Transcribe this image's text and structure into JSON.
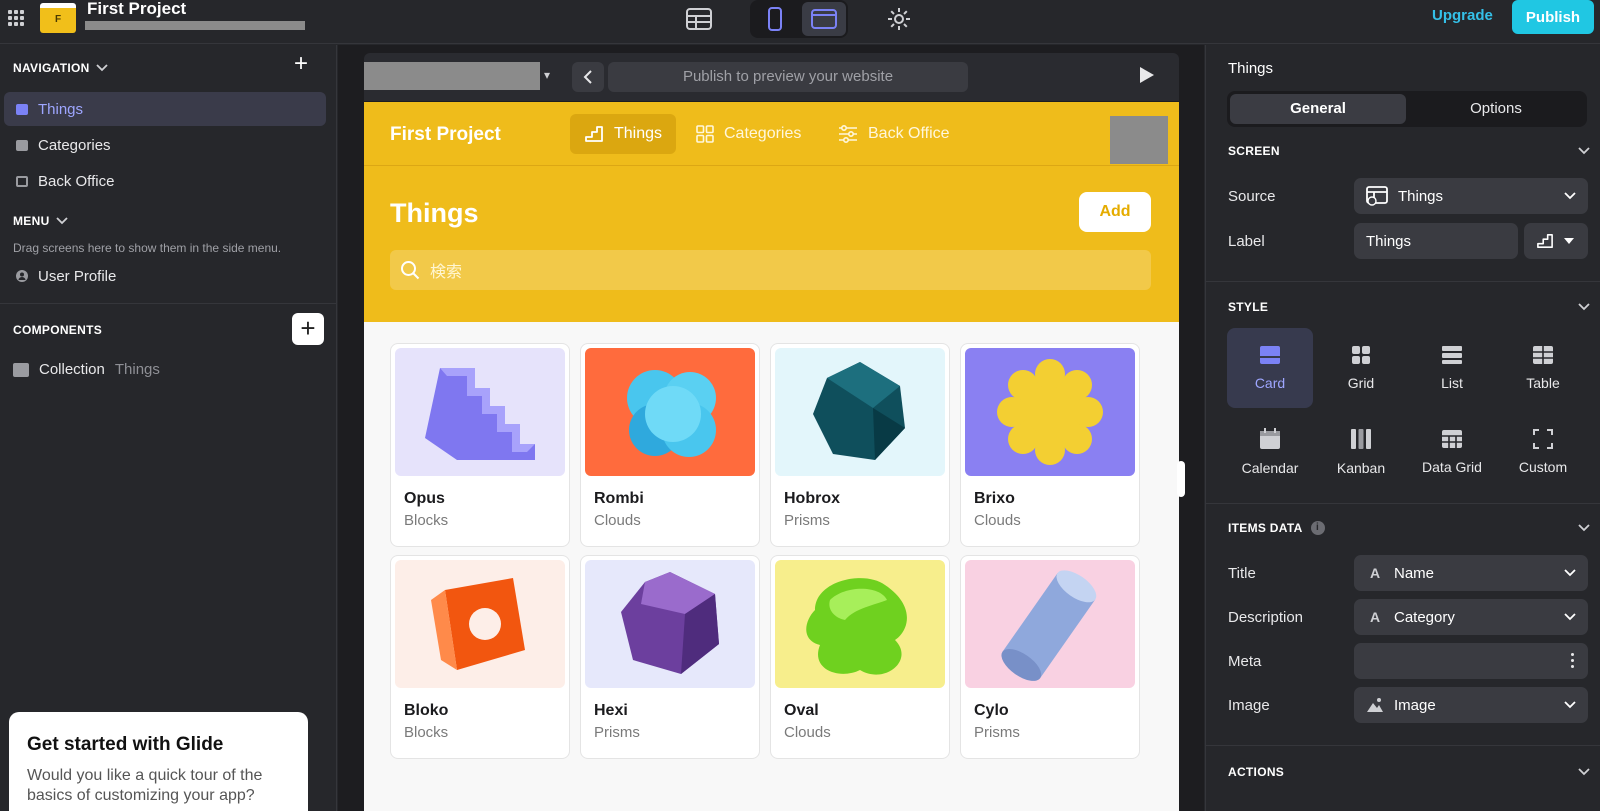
{
  "topbar": {
    "project_badge": "F",
    "project_title": "First Project",
    "upgrade_label": "Upgrade",
    "publish_label": "Publish"
  },
  "left": {
    "navigation_header": "NAVIGATION",
    "nav_items": [
      {
        "label": "Things",
        "icon": "card-icon",
        "active": true
      },
      {
        "label": "Categories",
        "icon": "card-icon"
      },
      {
        "label": "Back Office",
        "icon": "table-icon"
      }
    ],
    "menu_header": "MENU",
    "menu_hint": "Drag screens here to show them in the side menu.",
    "menu_items": [
      {
        "label": "User Profile",
        "icon": "user-icon"
      }
    ],
    "components_header": "COMPONENTS",
    "component": {
      "label": "Collection",
      "source": "Things"
    },
    "tour": {
      "title": "Get started with Glide",
      "text": "Would you like a quick tour of the basics of customizing your app?"
    }
  },
  "preview": {
    "url_placeholder": "Publish to preview your website",
    "app": {
      "brand": "First Project",
      "tabs": [
        {
          "label": "Things",
          "icon": "stairs-icon",
          "active": true
        },
        {
          "label": "Categories",
          "icon": "grid-icon"
        },
        {
          "label": "Back Office",
          "icon": "sliders-icon"
        }
      ],
      "screen_title": "Things",
      "add_label": "Add",
      "search_placeholder": "検索",
      "cards": [
        {
          "title": "Opus",
          "subtitle": "Blocks",
          "bg": "#e6e3fb",
          "shape": "stairs"
        },
        {
          "title": "Rombi",
          "subtitle": "Clouds",
          "bg": "#ff6b3d",
          "shape": "cloud"
        },
        {
          "title": "Hobrox",
          "subtitle": "Prisms",
          "bg": "#e3f6fb",
          "shape": "gem"
        },
        {
          "title": "Brixo",
          "subtitle": "Clouds",
          "bg": "#8a80f2",
          "shape": "star"
        },
        {
          "title": "Bloko",
          "subtitle": "Blocks",
          "bg": "#fdeee8",
          "shape": "cube"
        },
        {
          "title": "Hexi",
          "subtitle": "Prisms",
          "bg": "#e6e8fb",
          "shape": "hex"
        },
        {
          "title": "Oval",
          "subtitle": "Clouds",
          "bg": "#f7ee8c",
          "shape": "blob"
        },
        {
          "title": "Cylo",
          "subtitle": "Prisms",
          "bg": "#f9d1e2",
          "shape": "cylinder"
        }
      ]
    }
  },
  "right": {
    "title": "Things",
    "tabs": [
      {
        "label": "General",
        "active": true
      },
      {
        "label": "Options"
      }
    ],
    "screen_section": "SCREEN",
    "source_label": "Source",
    "source_value": "Things",
    "label_label": "Label",
    "label_value": "Things",
    "style_section": "STYLE",
    "styles": [
      {
        "label": "Card",
        "active": true
      },
      {
        "label": "Grid"
      },
      {
        "label": "List"
      },
      {
        "label": "Table"
      },
      {
        "label": "Calendar"
      },
      {
        "label": "Kanban"
      },
      {
        "label": "Data Grid"
      },
      {
        "label": "Custom"
      }
    ],
    "items_section": "ITEMS DATA",
    "items": [
      {
        "label": "Title",
        "value": "Name",
        "icon": "text-icon"
      },
      {
        "label": "Description",
        "value": "Category",
        "icon": "text-icon"
      },
      {
        "label": "Meta",
        "value": ""
      },
      {
        "label": "Image",
        "value": "Image",
        "icon": "image-icon"
      }
    ],
    "actions_section": "ACTIONS"
  },
  "colors": {
    "accent": "#20c7e3",
    "app_yellow": "#efbc1b",
    "active_nav": "#9ea6ff",
    "panel_bg": "#26272b"
  }
}
